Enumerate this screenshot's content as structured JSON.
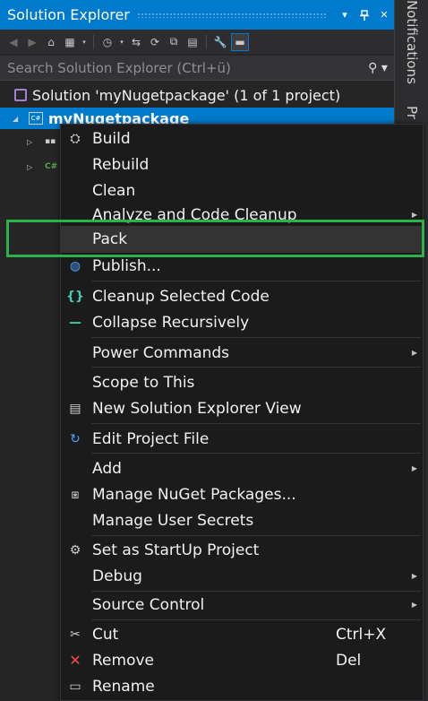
{
  "window": {
    "title": "Solution Explorer",
    "buttons": {
      "dropdown": "▾",
      "pin": "🖈",
      "close": "✕"
    }
  },
  "side_tabs": [
    "Notifications",
    "Pr"
  ],
  "search": {
    "placeholder": "Search Solution Explorer (Ctrl+ü)",
    "value": ""
  },
  "tree": {
    "solution_label": "Solution 'myNugetpackage' (1 of 1 project)",
    "project_label": "myNugetpackage"
  },
  "context_menu": {
    "items": [
      {
        "label": "Build"
      },
      {
        "label": "Rebuild"
      },
      {
        "label": "Clean"
      },
      {
        "label": "Analyze and Code Cleanup",
        "submenu": true
      },
      {
        "label": "Pack",
        "highlighted": true
      },
      {
        "label": "Publish..."
      },
      {
        "label": "Cleanup Selected Code"
      },
      {
        "label": "Collapse Recursively"
      },
      {
        "label": "Power Commands",
        "submenu": true
      },
      {
        "label": "Scope to This"
      },
      {
        "label": "New Solution Explorer View"
      },
      {
        "label": "Edit Project File"
      },
      {
        "label": "Add",
        "submenu": true
      },
      {
        "label": "Manage NuGet Packages..."
      },
      {
        "label": "Manage User Secrets"
      },
      {
        "label": "Set as StartUp Project"
      },
      {
        "label": "Debug",
        "submenu": true
      },
      {
        "label": "Source Control",
        "submenu": true
      },
      {
        "label": "Cut",
        "shortcut": "Ctrl+X"
      },
      {
        "label": "Remove",
        "shortcut": "Del"
      },
      {
        "label": "Rename"
      }
    ]
  },
  "colors": {
    "accent": "#007acc",
    "highlight_box": "#2bb34a",
    "menu_bg": "#1b1b1c",
    "panel_bg": "#252526"
  }
}
